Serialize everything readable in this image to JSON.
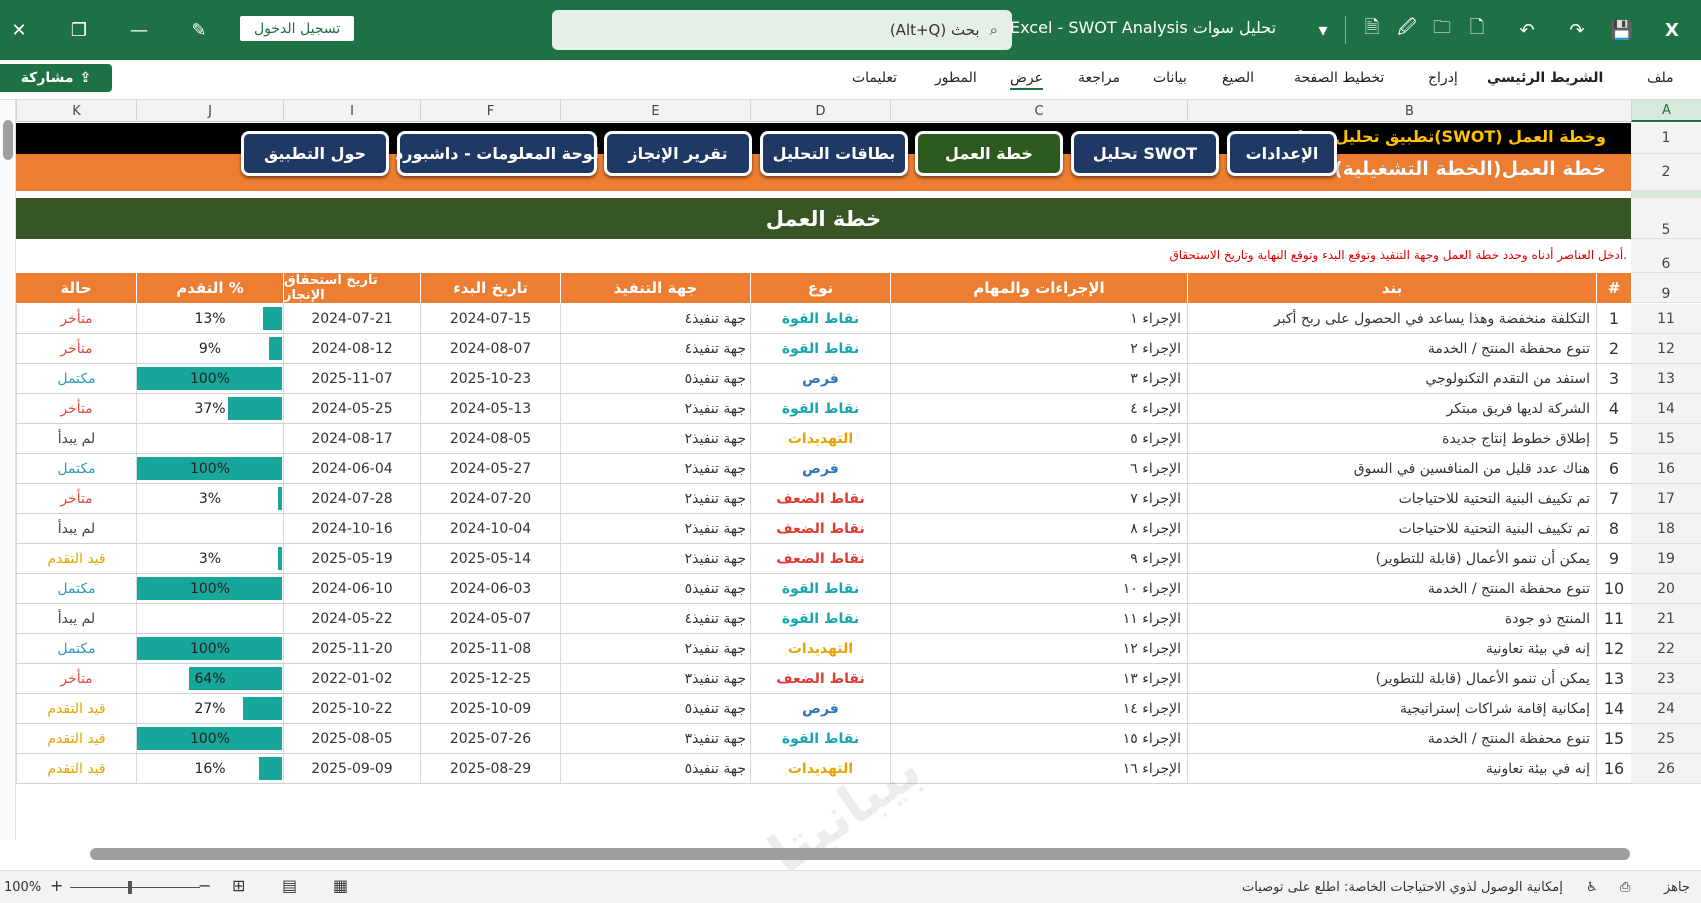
{
  "titlebar": {
    "signin": "تسجيل الدخول",
    "search_placeholder": "(Alt+Q) بحث",
    "window_title": "Excel - SWOT Analysis تحليل سوات"
  },
  "menu": {
    "share": "مشاركة",
    "items": [
      "ملف",
      "الشريط الرئيسي",
      "إدراج",
      "تخطيط الصفحة",
      "الصيغ",
      "بيانات",
      "مراجعة",
      "عرض",
      "المطور",
      "تعليمات"
    ]
  },
  "columns": [
    "A",
    "B",
    "C",
    "D",
    "E",
    "F",
    "I",
    "J",
    "K"
  ],
  "row_numbers": [
    "1",
    "2",
    "5",
    "6",
    "9",
    "11",
    "12",
    "13",
    "14",
    "15",
    "16",
    "17",
    "18",
    "19",
    "20",
    "21",
    "22",
    "23",
    "24",
    "25",
    "26"
  ],
  "sheet": {
    "app_title": "تطبيق تحليل سوات(SWOT) وخطة العمل",
    "subtitle": "خطة العمل(الخطة التشغيلية)",
    "nav": [
      "الإعدادات",
      "تحليل SWOT",
      "خطة العمل",
      "بطاقات التحليل",
      "تقرير الإنجاز",
      "لوحة المعلومات - داشبورد",
      "حول التطبيق"
    ],
    "banner": "خطة العمل",
    "note": "أدخل العناصر أدناه وحدد خطة العمل وجهة التنفيذ وتوقع البدء وتوقع النهاية وتاريخ الاستحقاق.",
    "headers": {
      "num": "#",
      "item": "بند",
      "action": "الإجراءات والمهام",
      "type": "نوع",
      "exec": "جهة التنفيذ",
      "start": "تاريخ البدء",
      "due": "تاريخ استحقاق الإنجاز",
      "progress": "التقدم %",
      "status": "حالة"
    }
  },
  "colors": {
    "strength": "#17a6b0",
    "weakness": "#e03c31",
    "opportunity": "#2e75b6",
    "threat": "#e5a400",
    "late": "#e04a3c",
    "done": "#2e9bc0",
    "notstarted": "#444444",
    "inprogress": "#e5a400"
  },
  "rows": [
    {
      "n": "1",
      "item": "التكلفة منخفضة وهذا يساعد في الحصول على ربح أكبر",
      "action": "الإجراء ١",
      "type": "نقاط القوة",
      "tk": "strength",
      "exec": "جهة تنفيذ٤",
      "start": "2024-07-15",
      "due": "2024-07-21",
      "p": 0.13,
      "pt": "13%",
      "status": "متأخر",
      "sk": "late"
    },
    {
      "n": "2",
      "item": "تنوع محفظة المنتج / الخدمة",
      "action": "الإجراء ٢",
      "type": "نقاط القوة",
      "tk": "strength",
      "exec": "جهة تنفيذ٤",
      "start": "2024-08-07",
      "due": "2024-08-12",
      "p": 0.09,
      "pt": "9%",
      "status": "متأخر",
      "sk": "late"
    },
    {
      "n": "3",
      "item": "استفد من التقدم التكنولوجي",
      "action": "الإجراء ٣",
      "type": "فرص",
      "tk": "opportunity",
      "exec": "جهة تنفيذ٥",
      "start": "2025-10-23",
      "due": "2025-11-07",
      "p": 1.0,
      "pt": "100%",
      "status": "مكتمل",
      "sk": "done"
    },
    {
      "n": "4",
      "item": "الشركة لديها فريق مبتكر",
      "action": "الإجراء ٤",
      "type": "نقاط القوة",
      "tk": "strength",
      "exec": "جهة تنفيذ٢",
      "start": "2024-05-13",
      "due": "2024-05-25",
      "p": 0.37,
      "pt": "37%",
      "status": "متأخر",
      "sk": "late"
    },
    {
      "n": "5",
      "item": "إطلاق خطوط إنتاج جديدة",
      "action": "الإجراء ٥",
      "type": "التهديدات",
      "tk": "threat",
      "exec": "جهة تنفيذ٢",
      "start": "2024-08-05",
      "due": "2024-08-17",
      "p": 0,
      "pt": "",
      "status": "لم يبدأ",
      "sk": "notstarted"
    },
    {
      "n": "6",
      "item": "هناك عدد قليل من المنافسين في السوق",
      "action": "الإجراء ٦",
      "type": "فرص",
      "tk": "opportunity",
      "exec": "جهة تنفيذ٢",
      "start": "2024-05-27",
      "due": "2024-06-04",
      "p": 1.0,
      "pt": "100%",
      "status": "مكتمل",
      "sk": "done"
    },
    {
      "n": "7",
      "item": "تم تكييف البنية التحتية للاحتياجات",
      "action": "الإجراء ٧",
      "type": "نقاط الضعف",
      "tk": "weakness",
      "exec": "جهة تنفيذ٢",
      "start": "2024-07-20",
      "due": "2024-07-28",
      "p": 0.03,
      "pt": "3%",
      "status": "متأخر",
      "sk": "late"
    },
    {
      "n": "8",
      "item": "تم تكييف البنية التحتية للاحتياجات",
      "action": "الإجراء ٨",
      "type": "نقاط الضعف",
      "tk": "weakness",
      "exec": "جهة تنفيذ٢",
      "start": "2024-10-04",
      "due": "2024-10-16",
      "p": 0,
      "pt": "",
      "status": "لم يبدأ",
      "sk": "notstarted"
    },
    {
      "n": "9",
      "item": "يمكن أن تنمو الأعمال (قابلة للتطوير)",
      "action": "الإجراء ٩",
      "type": "نقاط الضعف",
      "tk": "weakness",
      "exec": "جهة تنفيذ٢",
      "start": "2025-05-14",
      "due": "2025-05-19",
      "p": 0.03,
      "pt": "3%",
      "status": "قيد التقدم",
      "sk": "inprogress"
    },
    {
      "n": "10",
      "item": "تنوع محفظة المنتج / الخدمة",
      "action": "الإجراء ١٠",
      "type": "نقاط القوة",
      "tk": "strength",
      "exec": "جهة تنفيذ٥",
      "start": "2024-06-03",
      "due": "2024-06-10",
      "p": 1.0,
      "pt": "100%",
      "status": "مكتمل",
      "sk": "done"
    },
    {
      "n": "11",
      "item": "المنتج ذو جودة",
      "action": "الإجراء ١١",
      "type": "نقاط القوة",
      "tk": "strength",
      "exec": "جهة تنفيذ٤",
      "start": "2024-05-07",
      "due": "2024-05-22",
      "p": 0,
      "pt": "",
      "status": "لم يبدأ",
      "sk": "notstarted"
    },
    {
      "n": "12",
      "item": "إنه في بيئة تعاونية",
      "action": "الإجراء ١٢",
      "type": "التهديدات",
      "tk": "threat",
      "exec": "جهة تنفيذ٢",
      "start": "2025-11-08",
      "due": "2025-11-20",
      "p": 1.0,
      "pt": "100%",
      "status": "مكتمل",
      "sk": "done"
    },
    {
      "n": "13",
      "item": "يمكن أن تنمو الأعمال (قابلة للتطوير)",
      "action": "الإجراء ١٣",
      "type": "نقاط الضعف",
      "tk": "weakness",
      "exec": "جهة تنفيذ٣",
      "start": "2025-12-25",
      "due": "2022-01-02",
      "p": 0.64,
      "pt": "64%",
      "status": "متأخر",
      "sk": "late"
    },
    {
      "n": "14",
      "item": "إمكانية إقامة شراكات إستراتيجية",
      "action": "الإجراء ١٤",
      "type": "فرص",
      "tk": "opportunity",
      "exec": "جهة تنفيذ٥",
      "start": "2025-10-09",
      "due": "2025-10-22",
      "p": 0.27,
      "pt": "27%",
      "status": "قيد التقدم",
      "sk": "inprogress"
    },
    {
      "n": "15",
      "item": "تنوع محفظة المنتج / الخدمة",
      "action": "الإجراء ١٥",
      "type": "نقاط القوة",
      "tk": "strength",
      "exec": "جهة تنفيذ٣",
      "start": "2025-07-26",
      "due": "2025-08-05",
      "p": 1.0,
      "pt": "100%",
      "status": "قيد التقدم",
      "sk": "inprogress"
    },
    {
      "n": "16",
      "item": "إنه في بيئة تعاونية",
      "action": "الإجراء ١٦",
      "type": "التهديدات",
      "tk": "threat",
      "exec": "جهة تنفيذ٥",
      "start": "2025-08-29",
      "due": "2025-09-09",
      "p": 0.16,
      "pt": "16%",
      "status": "قيد التقدم",
      "sk": "inprogress"
    }
  ],
  "statusbar": {
    "ready": "جاهز",
    "accessibility": "إمكانية الوصول لذوي الاحتياجات الخاصة: اطلع على توصيات",
    "zoom": "100%"
  }
}
